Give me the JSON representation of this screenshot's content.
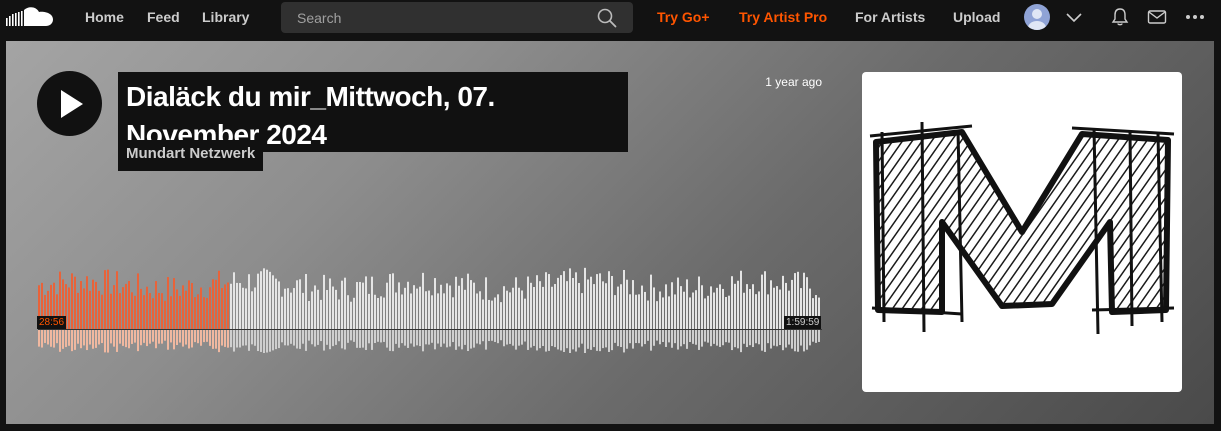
{
  "nav": {
    "home": "Home",
    "feed": "Feed",
    "library": "Library",
    "search_placeholder": "Search",
    "try_go": "Try Go+",
    "try_artist_pro": "Try Artist Pro",
    "for_artists": "For Artists",
    "upload": "Upload"
  },
  "track": {
    "title": "Dialäck du mir_Mittwoch, 07. November 2024",
    "artist": "Mundart Netzwerk",
    "posted": "1 year ago",
    "elapsed": "28:56",
    "duration": "1:59:59",
    "progress": 0.2412
  },
  "icons": {
    "logo": "soundcloud-logo",
    "search": "search-icon",
    "avatar": "avatar",
    "chevron": "chevron-down-icon",
    "bell": "bell-icon",
    "mail": "mail-icon",
    "more": "more-icon",
    "play": "play-icon"
  },
  "colors": {
    "accent": "#ff5500",
    "played_bar": "#e8633a",
    "unplayed_bar": "#e5e5e5"
  }
}
